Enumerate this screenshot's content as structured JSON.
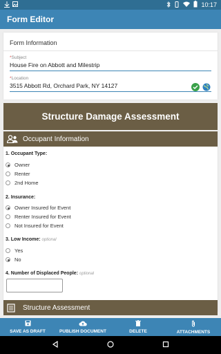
{
  "status_bar": {
    "time": "10:17"
  },
  "app_bar": {
    "title": "Form Editor"
  },
  "form": {
    "header": "Form Information",
    "subject": {
      "label": "Subject",
      "value": "House Fire on Abbott and Milestrip"
    },
    "location": {
      "label": "Location",
      "value": "3515 Abbott Rd, Orchard Park, NY 14127"
    }
  },
  "banner": {
    "title": "Structure Damage Assessment"
  },
  "occupant_section": {
    "title": "Occupant Information",
    "questions": [
      {
        "label": "1. Occupant Type:",
        "options": [
          "Owner",
          "Renter",
          "2nd Home"
        ],
        "selected": 0
      },
      {
        "label": "2. Insurance:",
        "options": [
          "Owner Insured for Event",
          "Renter Insured for Event",
          "Not Insured for Event"
        ],
        "selected": 0
      },
      {
        "label": "3. Low Income:",
        "optional": "optional",
        "options": [
          "Yes",
          "No"
        ],
        "selected": 1
      },
      {
        "label": "4. Number of Displaced People:",
        "optional": "optional"
      }
    ]
  },
  "structure_section": {
    "title": "Structure Assessment"
  },
  "bottom_bar": {
    "save_draft": "SAVE AS DRAFT",
    "publish": "PUBLISH DOCUMENT",
    "delete": "DELETE",
    "attachments": "ATTACHMENTS"
  },
  "colors": {
    "primary": "#3d85b5",
    "status_bar": "#2f6e93",
    "section_header": "#6b5e45",
    "valid_check": "#3aa14a"
  }
}
